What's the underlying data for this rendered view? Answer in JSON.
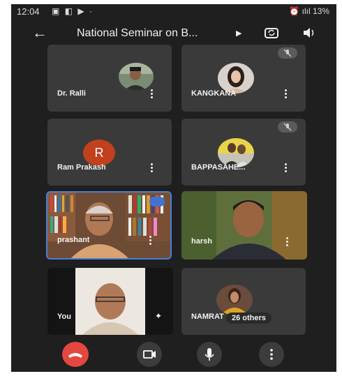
{
  "status_bar": {
    "time": "12:04",
    "left_icons": [
      "gallery-icon",
      "ui-icon",
      "youtube-icon"
    ],
    "right_text": "13%"
  },
  "app_bar": {
    "title": "National Seminar on B...",
    "back_icon": "back-arrow-icon",
    "switch_camera_icon": "switch-camera-icon",
    "audio_icon": "speaker-icon"
  },
  "participants": [
    {
      "name": "Dr. Ralli",
      "muted": false
    },
    {
      "name": "KANGKANA",
      "muted": true
    },
    {
      "name": "Ram Prakash",
      "initial": "R",
      "muted": false
    },
    {
      "name": "BAPPASAHE...",
      "muted": true
    },
    {
      "name": "prashant",
      "speaking": true
    },
    {
      "name": "harsh"
    },
    {
      "name": "You"
    },
    {
      "name": "NAMRAT",
      "others_label": "26 others"
    }
  ],
  "controls": [
    "end-call",
    "camera",
    "microphone",
    "more-options"
  ],
  "colors": {
    "background": "#1f1f1f",
    "tile": "#3a3a3a",
    "end_call": "#e4473f",
    "avatar_r": "#c1401d",
    "speaking_border": "#4a7fd6"
  }
}
